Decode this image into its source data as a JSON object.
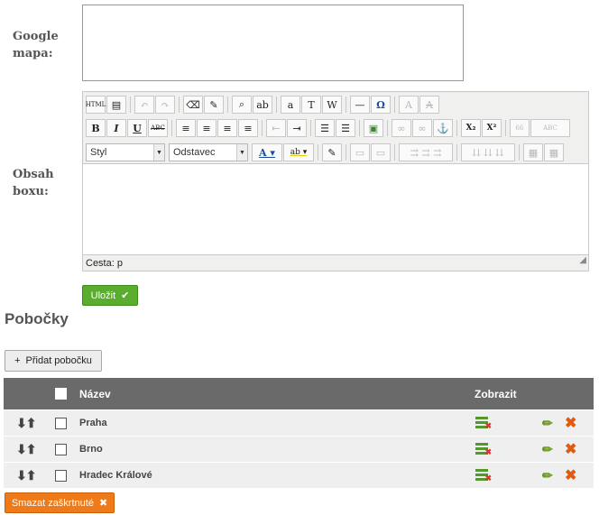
{
  "form": {
    "google_label_1": "Google",
    "google_label_2": "mapa:",
    "obsah_label_1": "Obsah",
    "obsah_label_2": "boxu:"
  },
  "editor": {
    "toolbar_row1": [
      "HTML",
      "▤",
      "↶",
      "↷",
      "⌫",
      "✎",
      "⌕",
      "ab",
      "a",
      "T",
      "W",
      "—",
      "Ω",
      "A",
      "A"
    ],
    "toolbar_row2": [
      "B",
      "I",
      "U",
      "ABC",
      "≡",
      "≡",
      "≡",
      "≡",
      "⇤",
      "⇥",
      "☰",
      "☰",
      "▣",
      "∞",
      "∞",
      "⚓",
      "X₂",
      "X²",
      "66",
      "ABC"
    ],
    "style_select": "Styl",
    "format_select": "Odstavec",
    "status": "Cesta: p"
  },
  "save_label": "Uložit",
  "section_title": "Pobočky",
  "add_label": "Přidat pobočku",
  "table": {
    "col_name": "Název",
    "col_show": "Zobrazit",
    "rows": [
      {
        "name": "Praha"
      },
      {
        "name": "Brno"
      },
      {
        "name": "Hradec Králové"
      }
    ]
  },
  "delete_label": "Smazat zaškrtnuté",
  "colors": {
    "save": "#5aad2e",
    "delete": "#ee7a1a",
    "header": "#6a6a6a"
  }
}
